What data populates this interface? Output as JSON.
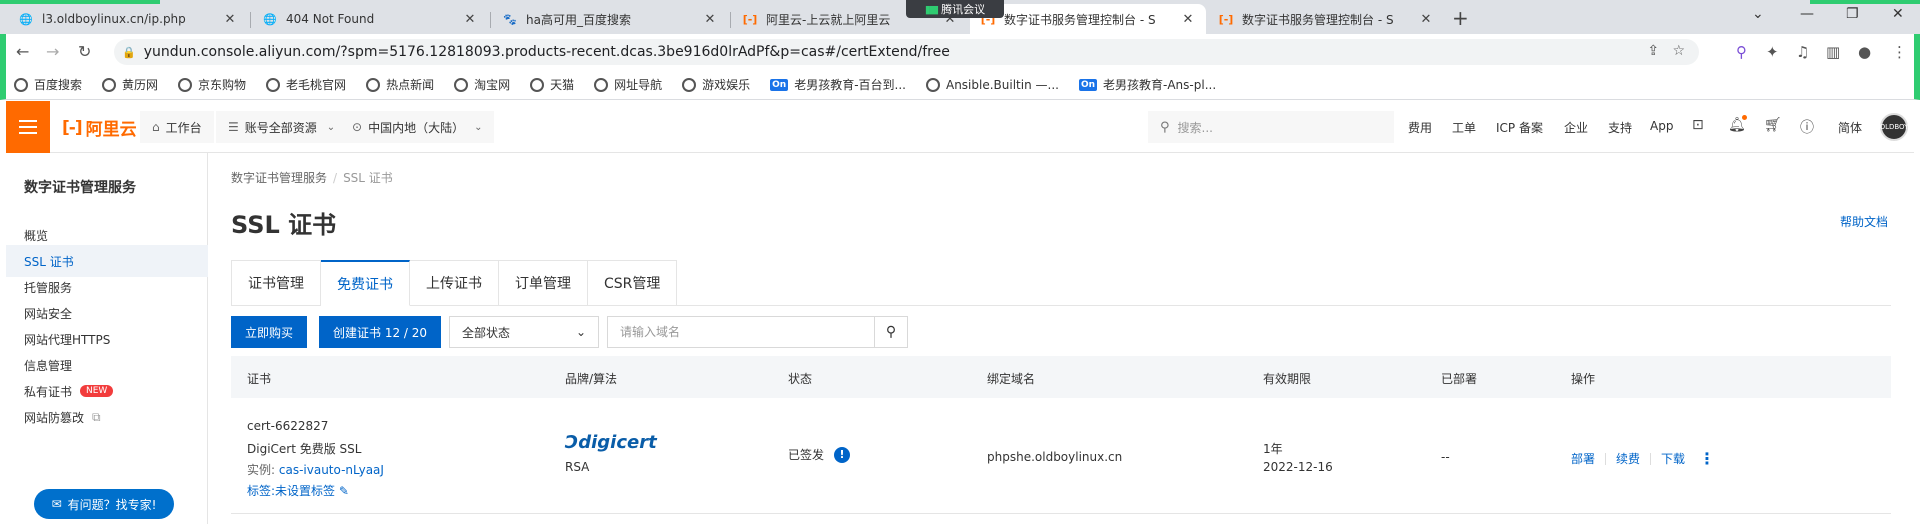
{
  "browser": {
    "tabs": [
      {
        "title": "l3.oldboylinux.cn/ip.php",
        "icon": "globe-icon"
      },
      {
        "title": "404 Not Found",
        "icon": "globe-icon"
      },
      {
        "title": "ha高可用_百度搜索",
        "icon": "baidu-paw-icon"
      },
      {
        "title": "阿里云-上云就上阿里云",
        "icon": "aliyun-icon"
      },
      {
        "title": "数字证书服务管理控制台 - S",
        "icon": "aliyun-icon"
      },
      {
        "title": "数字证书服务管理控制台 - S",
        "icon": "aliyun-icon"
      }
    ],
    "meeting_label": "腾讯会议",
    "url": "yundun.console.aliyun.com/?spm=5176.12818093.products-recent.dcas.3be916d0lrAdPf&p=cas#/certExtend/free",
    "bookmarks": [
      {
        "label": "百度搜索",
        "icon": "globe-icon"
      },
      {
        "label": "黄历网",
        "icon": "globe-icon"
      },
      {
        "label": "京东购物",
        "icon": "globe-icon"
      },
      {
        "label": "老毛桃官网",
        "icon": "globe-icon"
      },
      {
        "label": "热点新闻",
        "icon": "globe-icon"
      },
      {
        "label": "淘宝网",
        "icon": "globe-icon"
      },
      {
        "label": "天猫",
        "icon": "globe-icon"
      },
      {
        "label": "网址导航",
        "icon": "globe-icon"
      },
      {
        "label": "游戏娱乐",
        "icon": "globe-icon"
      },
      {
        "label": "老男孩教育-百台到...",
        "icon": "on-badge-icon"
      },
      {
        "label": "Ansible.Builtin —...",
        "icon": "globe-icon"
      },
      {
        "label": "老男孩教育-Ans-pl...",
        "icon": "on-badge-icon"
      }
    ],
    "on_badge": "On"
  },
  "topnav": {
    "brand": "阿里云",
    "workbench": "工作台",
    "account_resources": "账号全部资源",
    "region": "中国内地（大陆）",
    "search_placeholder": "搜索...",
    "links": [
      "费用",
      "工单",
      "ICP 备案",
      "企业",
      "支持",
      "App"
    ],
    "language": "简体",
    "avatar_text": "OLDBOY"
  },
  "sidebar": {
    "title": "数字证书管理服务",
    "items": [
      {
        "label": "概览"
      },
      {
        "label": "SSL 证书"
      },
      {
        "label": "托管服务"
      },
      {
        "label": "网站安全"
      },
      {
        "label": "网站代理HTTPS"
      },
      {
        "label": "信息管理"
      },
      {
        "label": "私有证书"
      },
      {
        "label": "网站防篡改"
      }
    ],
    "new_badge": "NEW",
    "help_button": "有问题？找专家!"
  },
  "main": {
    "breadcrumb": [
      "数字证书管理服务",
      "SSL 证书"
    ],
    "title": "SSL 证书",
    "help_doc": "帮助文档",
    "tabs": [
      "证书管理",
      "免费证书",
      "上传证书",
      "订单管理",
      "CSR管理"
    ],
    "active_tab": "免费证书",
    "buy_button": "立即购买",
    "create_button": "创建证书 12 / 20",
    "status_select": "全部状态",
    "domain_placeholder": "请输入域名",
    "columns": [
      "证书",
      "品牌/算法",
      "状态",
      "绑定域名",
      "有效期限",
      "已部署",
      "操作"
    ],
    "rows": [
      {
        "cert_id": "cert-6622827",
        "cert_name": "DigiCert 免费版 SSL",
        "instance_label": "实例:",
        "instance": "cas-ivauto-nLyaaJ",
        "tag": "标签:未设置标签",
        "brand": "digicert",
        "algorithm": "RSA",
        "status": "已签发",
        "domain": "phpshe.oldboylinux.cn",
        "validity": "1年",
        "expiry": "2022-12-16",
        "deployed": "--",
        "actions": [
          "部署",
          "续费",
          "下载"
        ]
      }
    ]
  }
}
